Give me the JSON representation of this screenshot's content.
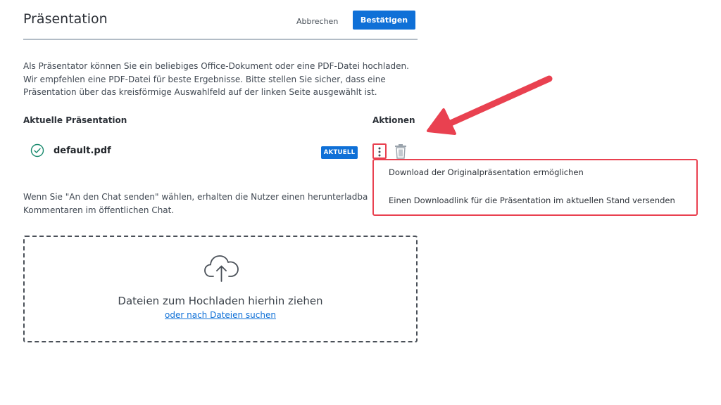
{
  "header": {
    "title": "Präsentation",
    "cancel_label": "Abbrechen",
    "confirm_label": "Bestätigen"
  },
  "intro_text": "Als Präsentator können Sie ein beliebiges Office-Dokument oder eine PDF-Datei hochladen. Wir empfehlen eine PDF-Datei für beste Ergebnisse. Bitte stellen Sie sicher, dass eine Präsentation über das kreisförmige Auswahlfeld auf der linken Seite ausgewählt ist.",
  "table": {
    "current_heading": "Aktuelle Präsentation",
    "actions_heading": "Aktionen",
    "rows": [
      {
        "filename": "default.pdf",
        "badge": "AKTUELL"
      }
    ]
  },
  "actions_menu": {
    "items": [
      "Download der Originalpräsentation ermöglichen",
      "Einen Downloadlink für die Präsentation im aktuellen Stand versenden"
    ]
  },
  "chat_note": {
    "line1": "Wenn Sie \"An den Chat senden\" wählen, erhalten die Nutzer einen herunterladbaren",
    "line2": "Kommentaren im öffentlichen Chat."
  },
  "dropzone": {
    "text": "Dateien zum Hochladen hierhin ziehen",
    "browse_link": "oder nach Dateien suchen"
  },
  "icons": {
    "check": "check-circle-icon",
    "more": "more-vertical-icon",
    "trash": "trash-icon",
    "upload": "cloud-upload-icon",
    "annotation": "red-arrow-annotation"
  },
  "colors": {
    "accent": "#0f70d7",
    "highlight": "#e94150",
    "check": "#1a8a6e"
  }
}
